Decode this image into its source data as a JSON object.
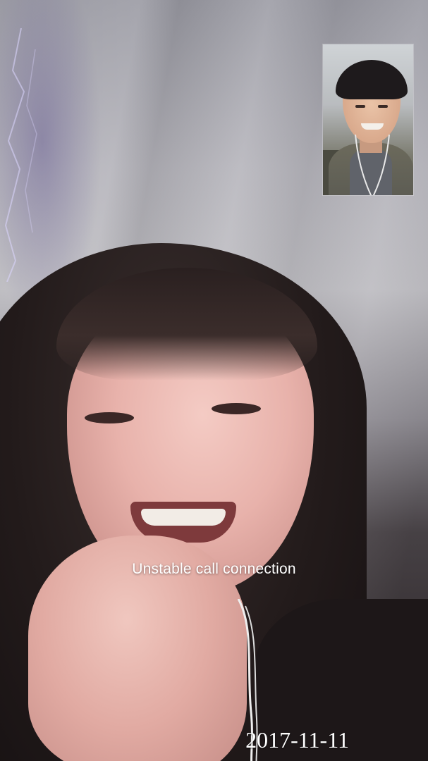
{
  "call": {
    "status_message": "Unstable call connection",
    "date_stamp": "2017-11-11"
  },
  "colors": {
    "status_text": "#ffffff",
    "date_text": "#ffffff"
  },
  "icons": {
    "self_view": "self-video-thumbnail",
    "remote_view": "remote-video-feed"
  }
}
